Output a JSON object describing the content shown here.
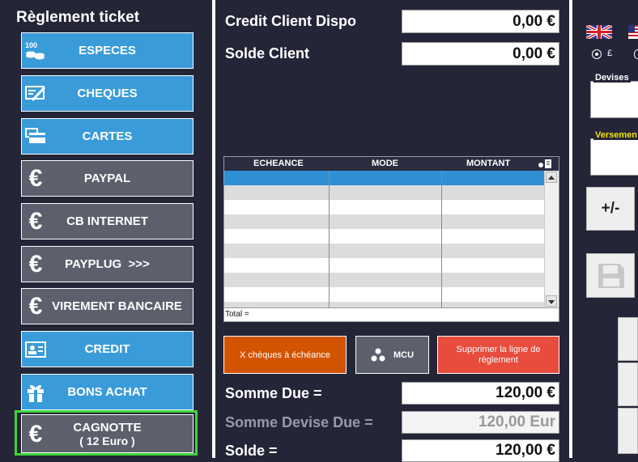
{
  "left_panel": {
    "title": "Règlement ticket",
    "buttons": [
      {
        "label": "ESPECES",
        "icon": "cash-icon"
      },
      {
        "label": "CHEQUES",
        "icon": "cheque-icon"
      },
      {
        "label": "CARTES",
        "icon": "card-icon"
      },
      {
        "label": "PAYPAL",
        "icon": "euro-icon"
      },
      {
        "label": "CB INTERNET",
        "icon": "euro-icon"
      },
      {
        "label": "PAYPLUG  >>>",
        "icon": "euro-icon"
      },
      {
        "label": "VIREMENT BANCAIRE",
        "icon": "euro-icon"
      },
      {
        "label": "CREDIT",
        "icon": "id-card-icon"
      },
      {
        "label": "BONS ACHAT",
        "icon": "gift-icon"
      },
      {
        "label": "CAGNOTTE",
        "sublabel": "( 12 Euro )",
        "icon": "euro-icon"
      }
    ],
    "cash_icon_text": "100"
  },
  "center": {
    "credit_label": "Credit Client Dispo",
    "credit_value": "0,00 €",
    "solde_client_label": "Solde Client",
    "solde_client_value": "0,00 €",
    "table": {
      "columns": [
        "ECHEANCE",
        "MODE",
        "MONTANT"
      ],
      "total_label": "Total ="
    },
    "buttons": {
      "cheques": "X chèques à échéance",
      "mcu": "MCU",
      "supprimer": "Supprimer la ligne de règlement"
    },
    "somme_due_label": "Somme Due =",
    "somme_due_value": "120,00 €",
    "somme_devise_label": "Somme Devise Due =",
    "somme_devise_value": "120,00 Eur",
    "solde_label": "Solde =",
    "solde_value": "120,00 €"
  },
  "right_panel": {
    "currency_radio_label": "£",
    "devises_legend": "Devises",
    "versement_legend": "Versemen",
    "plus_minus": "+/-"
  },
  "colors": {
    "background": "#252538",
    "blue_button": "#3a9bd9",
    "grey_button": "#5d5f6c",
    "orange_button": "#d35400",
    "red_button": "#e74c3c",
    "selected_border": "#3dd43a",
    "grid_selected": "#2e8fd4"
  }
}
